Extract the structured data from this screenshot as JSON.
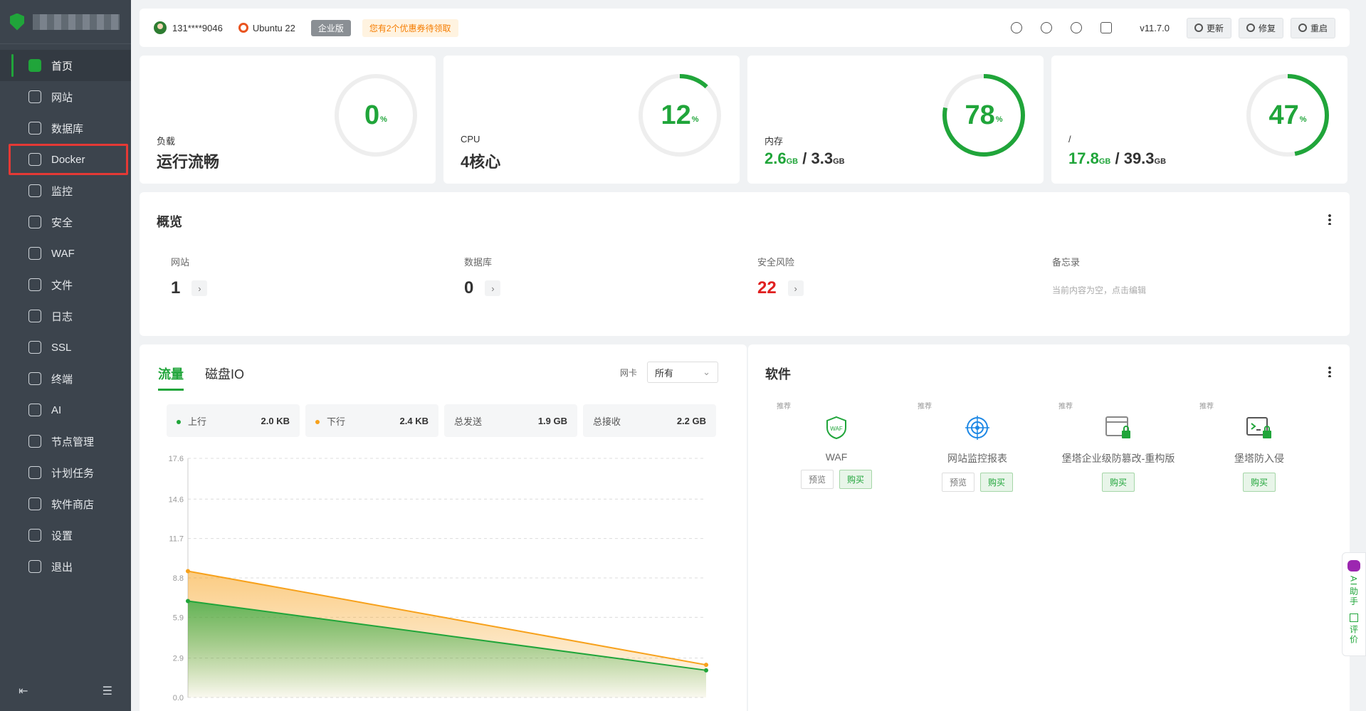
{
  "sidebar": {
    "items": [
      {
        "label": "首页",
        "icon": "home-icon"
      },
      {
        "label": "网站",
        "icon": "website-icon"
      },
      {
        "label": "数据库",
        "icon": "database-icon"
      },
      {
        "label": "Docker",
        "icon": "docker-icon"
      },
      {
        "label": "监控",
        "icon": "monitor-icon"
      },
      {
        "label": "安全",
        "icon": "shield-icon"
      },
      {
        "label": "WAF",
        "icon": "waf-icon"
      },
      {
        "label": "文件",
        "icon": "folder-icon"
      },
      {
        "label": "日志",
        "icon": "log-icon"
      },
      {
        "label": "SSL",
        "icon": "ssl-icon"
      },
      {
        "label": "终端",
        "icon": "terminal-icon"
      },
      {
        "label": "AI",
        "icon": "ai-icon"
      },
      {
        "label": "节点管理",
        "icon": "node-icon"
      },
      {
        "label": "计划任务",
        "icon": "calendar-icon"
      },
      {
        "label": "软件商店",
        "icon": "store-icon"
      },
      {
        "label": "设置",
        "icon": "gear-icon"
      },
      {
        "label": "退出",
        "icon": "logout-icon"
      }
    ]
  },
  "topbar": {
    "user": "131****9046",
    "os": "Ubuntu 22",
    "edition": "企业版",
    "coupon": "您有2个优惠券待领取",
    "version": "v11.7.0",
    "update": "更新",
    "repair": "修复",
    "restart": "重启"
  },
  "stats": {
    "load": {
      "label": "负载",
      "text": "运行流畅",
      "percent": 0,
      "unit": "%"
    },
    "cpu": {
      "label": "CPU",
      "text": "4核心",
      "percent": 12,
      "unit": "%"
    },
    "mem": {
      "label": "内存",
      "used": "2.6",
      "used_unit": "GB",
      "sep": "/",
      "total": "3.3",
      "total_unit": "GB",
      "percent": 78,
      "unit": "%"
    },
    "disk": {
      "label": "/",
      "used": "17.8",
      "used_unit": "GB",
      "sep": "/",
      "total": "39.3",
      "total_unit": "GB",
      "percent": 47,
      "unit": "%"
    }
  },
  "overview": {
    "title": "概览",
    "site": {
      "label": "网站",
      "value": "1"
    },
    "db": {
      "label": "数据库",
      "value": "0"
    },
    "risk": {
      "label": "安全风险",
      "value": "22"
    },
    "memo": {
      "label": "备忘录",
      "text": "当前内容为空，点击编辑"
    }
  },
  "traffic": {
    "tab_flow": "流量",
    "tab_disk": "磁盘IO",
    "nic_label": "网卡",
    "nic_value": "所有",
    "up_label": "上行",
    "up_value": "2.0 KB",
    "down_label": "下行",
    "down_value": "2.4 KB",
    "sent_label": "总发送",
    "sent_value": "1.9 GB",
    "recv_label": "总接收",
    "recv_value": "2.2 GB"
  },
  "chart_data": {
    "type": "area",
    "x": [
      0,
      1
    ],
    "yticks": [
      "17.6",
      "14.6",
      "11.7",
      "8.8",
      "5.9",
      "2.9",
      "0.0"
    ],
    "ylim": [
      0,
      17.6
    ],
    "grid": true,
    "series": [
      {
        "name": "下行",
        "values": [
          9.3,
          2.4
        ],
        "color": "#f7a11b"
      },
      {
        "name": "上行",
        "values": [
          7.1,
          2.0
        ],
        "color": "#20a53a"
      }
    ]
  },
  "software": {
    "title": "软件",
    "recommend": "推荐",
    "preview": "预览",
    "buy": "购买",
    "items": [
      {
        "name": "WAF",
        "icon": "waf-shield-icon"
      },
      {
        "name": "网站监控报表",
        "icon": "target-icon"
      },
      {
        "name": "堡塔企业级防篡改-重构版",
        "icon": "window-lock-icon"
      },
      {
        "name": "堡塔防入侵",
        "icon": "terminal-lock-icon"
      }
    ]
  },
  "float": {
    "ai": "AI助手",
    "review": "评价"
  },
  "colors": {
    "accent": "#20a53a",
    "danger": "#e02020",
    "orange": "#f7a11b",
    "sidebar": "#3c444d"
  }
}
